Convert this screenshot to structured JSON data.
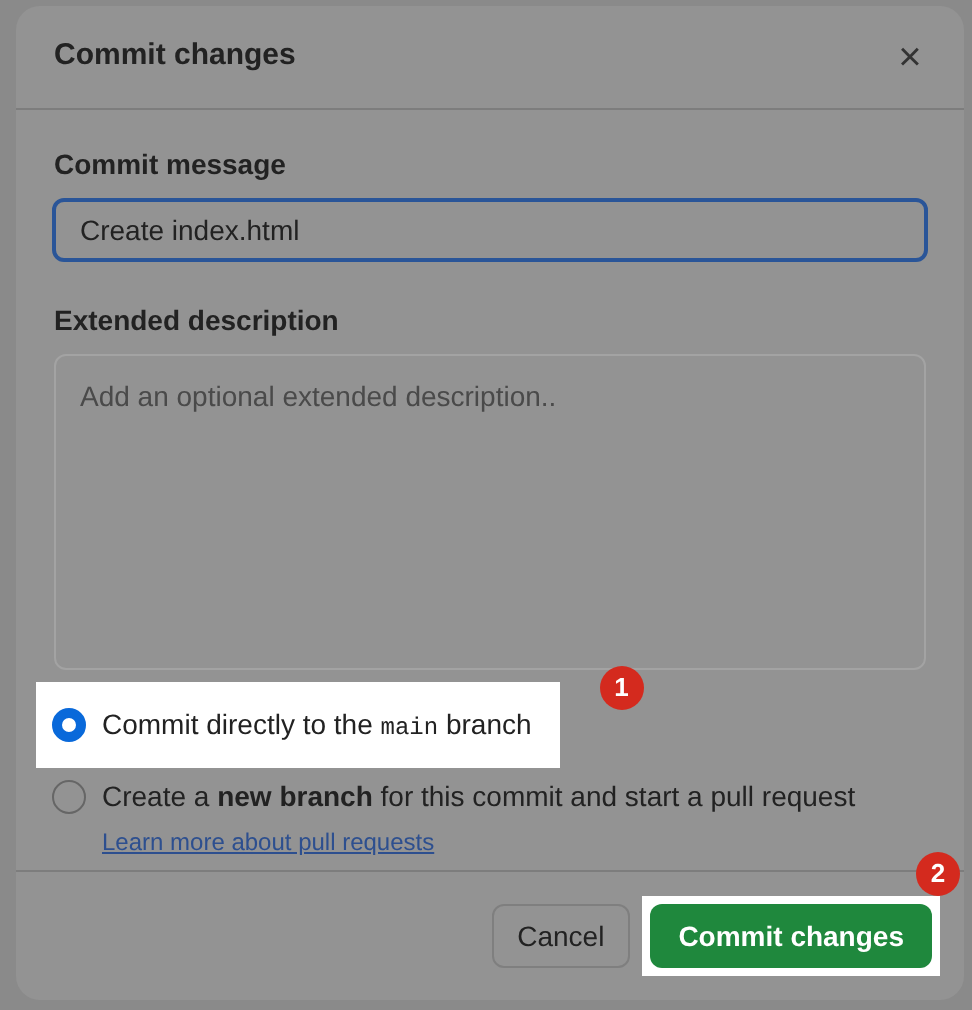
{
  "dialog": {
    "title": "Commit changes",
    "close": "×"
  },
  "commit_message": {
    "label": "Commit message",
    "value": "Create index.html"
  },
  "extended_description": {
    "label": "Extended description",
    "placeholder": "Add an optional extended description.."
  },
  "options": [
    {
      "kind": "code",
      "selected": true,
      "highlighted": true,
      "badge": "1",
      "before": "Commit directly to the",
      "code": "main",
      "after": "branch"
    },
    {
      "kind": "rich",
      "selected": false,
      "highlighted": false,
      "text": "Create a **new branch** for this commit and start a pull request",
      "link": "Learn more about pull requests"
    }
  ],
  "buttons": [
    {
      "label": "Cancel",
      "primary": false,
      "highlighted": false
    },
    {
      "label": "Commit changes",
      "primary": true,
      "highlighted": true,
      "badge": "2"
    }
  ]
}
